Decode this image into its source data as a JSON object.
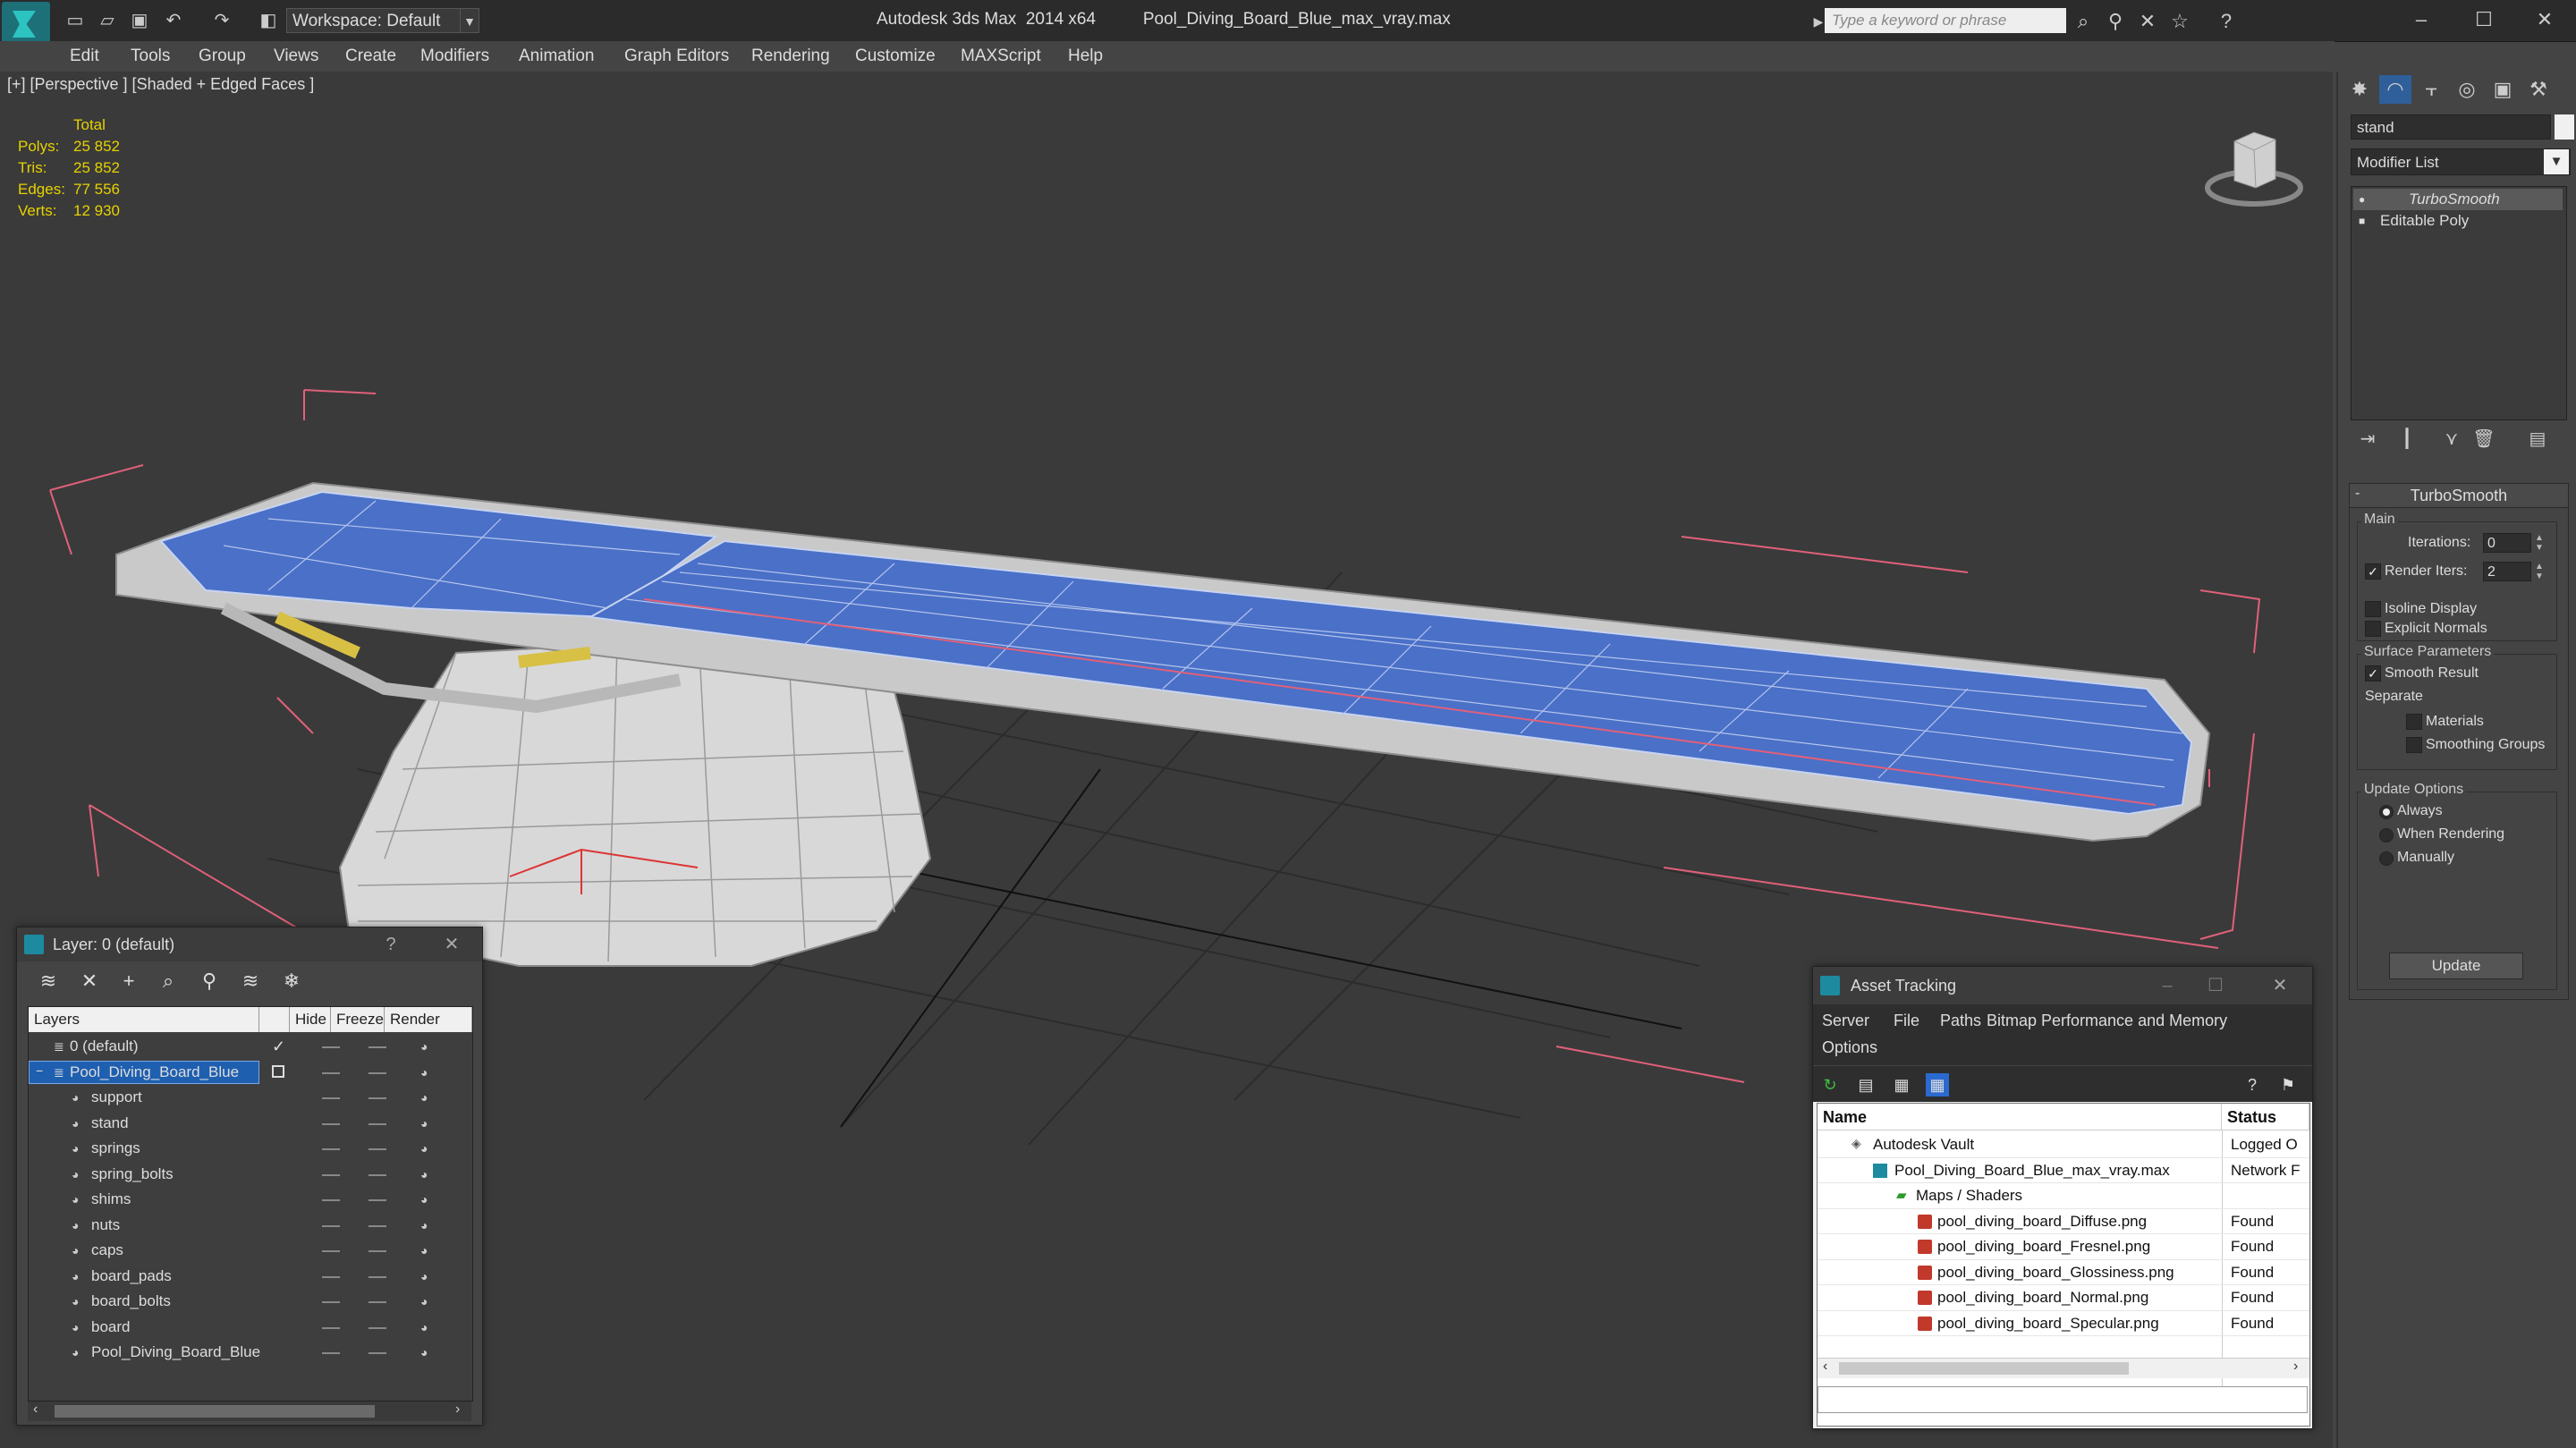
{
  "titlebar": {
    "workspace": "Workspace: Default",
    "app_name": "Autodesk 3ds Max  2014 x64",
    "file_name": "Pool_Diving_Board_Blue_max_vray.max",
    "search_placeholder": "Type a keyword or phrase"
  },
  "menu": [
    "Edit",
    "Tools",
    "Group",
    "Views",
    "Create",
    "Modifiers",
    "Animation",
    "Graph Editors",
    "Rendering",
    "Customize",
    "MAXScript",
    "Help"
  ],
  "viewport": {
    "label": "[+] [Perspective ] [Shaded + Edged Faces ]",
    "stats": {
      "header": "Total",
      "rows": [
        {
          "label": "Polys:",
          "value": "25 852"
        },
        {
          "label": "Tris:",
          "value": "25 852"
        },
        {
          "label": "Edges:",
          "value": "77 556"
        },
        {
          "label": "Verts:",
          "value": "12 930"
        }
      ]
    }
  },
  "command_panel": {
    "object_name": "stand",
    "modifier_list": "Modifier List",
    "stack": [
      "TurboSmooth",
      "Editable Poly"
    ],
    "rollout_title": "TurboSmooth",
    "main_group": "Main",
    "iterations_label": "Iterations:",
    "iterations_value": "0",
    "render_iters_label": "Render Iters:",
    "render_iters_value": "2",
    "isoline_label": "Isoline Display",
    "explicit_normals_label": "Explicit Normals",
    "surface_group": "Surface Parameters",
    "smooth_result_label": "Smooth Result",
    "separate_label": "Separate",
    "materials_label": "Materials",
    "smoothing_groups_label": "Smoothing Groups",
    "update_group": "Update Options",
    "always_label": "Always",
    "when_rendering_label": "When Rendering",
    "manually_label": "Manually",
    "update_button": "Update"
  },
  "layer_dialog": {
    "title": "Layer: 0 (default)",
    "help": "?",
    "columns": [
      "Layers",
      "Hide",
      "Freeze",
      "Render"
    ],
    "rows": [
      {
        "name": "0 (default)",
        "level": 0
      },
      {
        "name": "Pool_Diving_Board_Blue",
        "level": 0
      },
      {
        "name": "support",
        "level": 1
      },
      {
        "name": "stand",
        "level": 1
      },
      {
        "name": "springs",
        "level": 1
      },
      {
        "name": "spring_bolts",
        "level": 1
      },
      {
        "name": "shims",
        "level": 1
      },
      {
        "name": "nuts",
        "level": 1
      },
      {
        "name": "caps",
        "level": 1
      },
      {
        "name": "board_pads",
        "level": 1
      },
      {
        "name": "board_bolts",
        "level": 1
      },
      {
        "name": "board",
        "level": 1
      },
      {
        "name": "Pool_Diving_Board_Blue",
        "level": 1
      }
    ]
  },
  "asset_dialog": {
    "title": "Asset Tracking",
    "menu": [
      "Server",
      "File",
      "Paths",
      "Bitmap Performance and Memory",
      "Options"
    ],
    "columns": [
      "Name",
      "Status"
    ],
    "rows": [
      {
        "name": "Autodesk Vault",
        "status": "Logged O",
        "indent": 1
      },
      {
        "name": "Pool_Diving_Board_Blue_max_vray.max",
        "status": "Network F",
        "indent": 2
      },
      {
        "name": "Maps / Shaders",
        "status": "",
        "indent": 3
      },
      {
        "name": "pool_diving_board_Diffuse.png",
        "status": "Found",
        "indent": 4
      },
      {
        "name": "pool_diving_board_Fresnel.png",
        "status": "Found",
        "indent": 4
      },
      {
        "name": "pool_diving_board_Glossiness.png",
        "status": "Found",
        "indent": 4
      },
      {
        "name": "pool_diving_board_Normal.png",
        "status": "Found",
        "indent": 4
      },
      {
        "name": "pool_diving_board_Specular.png",
        "status": "Found",
        "indent": 4
      }
    ]
  },
  "colors": {
    "board_blue": "#4a70c8",
    "selection_blue": "#1f5fb0",
    "stats_yellow": "#e6d200",
    "bbox_pink": "#e0607a"
  }
}
